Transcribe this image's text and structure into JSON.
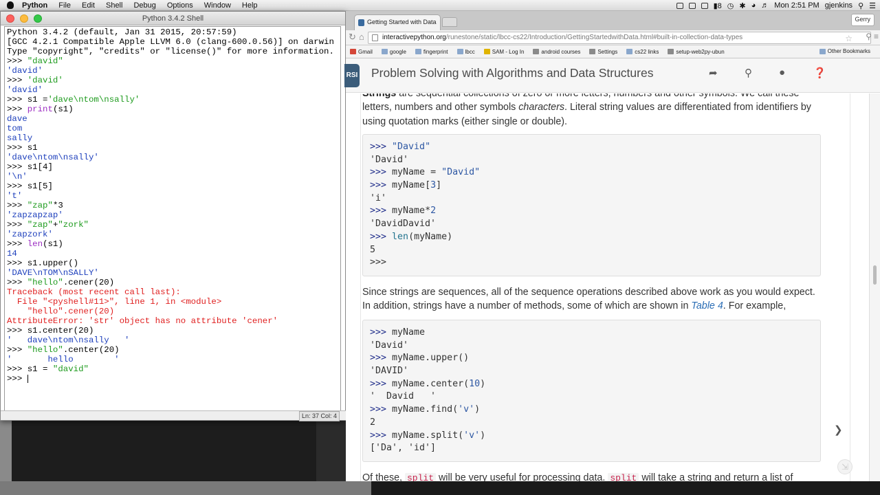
{
  "menubar": {
    "items": [
      "Python",
      "File",
      "Edit",
      "Shell",
      "Debug",
      "Options",
      "Window",
      "Help"
    ],
    "battery": "8",
    "clock": "Mon 2:51 PM",
    "user": "gjenkins"
  },
  "shell": {
    "title": "Python 3.4.2 Shell",
    "status": "Ln: 37 Col: 4",
    "lines": [
      {
        "segments": [
          {
            "t": "Python 3.4.2 (default, Jan 31 2015, 20:57:59)",
            "c": ""
          }
        ]
      },
      {
        "segments": [
          {
            "t": "[GCC 4.2.1 Compatible Apple LLVM 6.0 (clang-600.0.56)] on darwin",
            "c": ""
          }
        ]
      },
      {
        "segments": [
          {
            "t": "Type \"copyright\", \"credits\" or \"license()\" for more information.",
            "c": ""
          }
        ]
      },
      {
        "segments": [
          {
            "t": ">>> ",
            "c": ""
          },
          {
            "t": "\"david\"",
            "c": "str"
          }
        ]
      },
      {
        "segments": [
          {
            "t": "'david'",
            "c": "out"
          }
        ]
      },
      {
        "segments": [
          {
            "t": ">>> ",
            "c": ""
          },
          {
            "t": "'david'",
            "c": "str"
          }
        ]
      },
      {
        "segments": [
          {
            "t": "'david'",
            "c": "out"
          }
        ]
      },
      {
        "segments": [
          {
            "t": ">>> s1 =",
            "c": ""
          },
          {
            "t": "'dave\\ntom\\nsally'",
            "c": "str"
          }
        ]
      },
      {
        "segments": [
          {
            "t": ">>> ",
            "c": ""
          },
          {
            "t": "print",
            "c": "kw"
          },
          {
            "t": "(s1)",
            "c": ""
          }
        ]
      },
      {
        "segments": [
          {
            "t": "dave",
            "c": "out"
          }
        ]
      },
      {
        "segments": [
          {
            "t": "tom",
            "c": "out"
          }
        ]
      },
      {
        "segments": [
          {
            "t": "sally",
            "c": "out"
          }
        ]
      },
      {
        "segments": [
          {
            "t": ">>> s1",
            "c": ""
          }
        ]
      },
      {
        "segments": [
          {
            "t": "'dave\\ntom\\nsally'",
            "c": "out"
          }
        ]
      },
      {
        "segments": [
          {
            "t": ">>> s1[4]",
            "c": ""
          }
        ]
      },
      {
        "segments": [
          {
            "t": "'\\n'",
            "c": "out"
          }
        ]
      },
      {
        "segments": [
          {
            "t": ">>> s1[5]",
            "c": ""
          }
        ]
      },
      {
        "segments": [
          {
            "t": "'t'",
            "c": "out"
          }
        ]
      },
      {
        "segments": [
          {
            "t": ">>> ",
            "c": ""
          },
          {
            "t": "\"zap\"",
            "c": "str"
          },
          {
            "t": "*3",
            "c": ""
          }
        ]
      },
      {
        "segments": [
          {
            "t": "'zapzapzap'",
            "c": "out"
          }
        ]
      },
      {
        "segments": [
          {
            "t": ">>> ",
            "c": ""
          },
          {
            "t": "\"zap\"",
            "c": "str"
          },
          {
            "t": "+",
            "c": ""
          },
          {
            "t": "\"zork\"",
            "c": "str"
          }
        ]
      },
      {
        "segments": [
          {
            "t": "'zapzork'",
            "c": "out"
          }
        ]
      },
      {
        "segments": [
          {
            "t": ">>> ",
            "c": ""
          },
          {
            "t": "len",
            "c": "kw"
          },
          {
            "t": "(s1)",
            "c": ""
          }
        ]
      },
      {
        "segments": [
          {
            "t": "14",
            "c": "out"
          }
        ]
      },
      {
        "segments": [
          {
            "t": ">>> s1.upper()",
            "c": ""
          }
        ]
      },
      {
        "segments": [
          {
            "t": "'DAVE\\nTOM\\nSALLY'",
            "c": "out"
          }
        ]
      },
      {
        "segments": [
          {
            "t": ">>> ",
            "c": ""
          },
          {
            "t": "\"hello\"",
            "c": "str"
          },
          {
            "t": ".cener(20)",
            "c": ""
          }
        ]
      },
      {
        "segments": [
          {
            "t": "Traceback (most recent call last):",
            "c": "err"
          }
        ]
      },
      {
        "segments": [
          {
            "t": "  File \"<pyshell#11>\", line 1, in <module>",
            "c": "err"
          }
        ]
      },
      {
        "segments": [
          {
            "t": "    \"hello\".cener(20)",
            "c": "err"
          }
        ]
      },
      {
        "segments": [
          {
            "t": "AttributeError: 'str' object has no attribute 'cener'",
            "c": "err"
          }
        ]
      },
      {
        "segments": [
          {
            "t": ">>> s1.center(20)",
            "c": ""
          }
        ]
      },
      {
        "segments": [
          {
            "t": "'   dave\\ntom\\nsally   '",
            "c": "out"
          }
        ]
      },
      {
        "segments": [
          {
            "t": ">>> ",
            "c": ""
          },
          {
            "t": "\"hello\"",
            "c": "str"
          },
          {
            "t": ".center(20)",
            "c": ""
          }
        ]
      },
      {
        "segments": [
          {
            "t": "'       hello        '",
            "c": "out"
          }
        ]
      },
      {
        "segments": [
          {
            "t": ">>> s1 = ",
            "c": ""
          },
          {
            "t": "\"david\"",
            "c": "str"
          }
        ]
      },
      {
        "segments": [
          {
            "t": ">>> ",
            "c": ""
          }
        ],
        "caret": true
      }
    ]
  },
  "browser": {
    "tab_title": "Getting Started with Data",
    "profile": "Gerry",
    "url_domain": "interactivepython.org",
    "url_path": "/runestone/static/lbcc-cs22/Introduction/GettingStartedwithData.html#built-in-collection-data-types",
    "bookmarks": [
      {
        "label": "Gmail",
        "icon": "gmail-icon"
      },
      {
        "label": "google",
        "icon": "folder-icon"
      },
      {
        "label": "fingerprint",
        "icon": "folder-icon"
      },
      {
        "label": "lbcc",
        "icon": "folder-icon"
      },
      {
        "label": "SAM - Log In",
        "icon": "sam-icon"
      },
      {
        "label": "android courses",
        "icon": "page-icon"
      },
      {
        "label": "Settings",
        "icon": "gear-icon"
      },
      {
        "label": "cs22 links",
        "icon": "folder-icon"
      },
      {
        "label": "setup-web2py-ubun",
        "icon": "page-icon"
      }
    ],
    "other_bookmarks": "Other Bookmarks",
    "site_title": "Problem Solving with Algorithms and Data Structures",
    "logo_text": "RSI"
  },
  "content": {
    "p1": {
      "bold": "Strings",
      "text1": " are sequential collections of zero or more letters, numbers and other symbols. We call these letters, numbers and other symbols ",
      "italic": "characters",
      "text2": ". Literal string values are differentiated from identifiers by using quotation marks (either single or double)."
    },
    "code1": [
      [
        {
          "t": ">>> ",
          "c": "pr"
        },
        {
          "t": "\"David\"",
          "c": "s"
        }
      ],
      [
        {
          "t": "'David'",
          "c": ""
        }
      ],
      [
        {
          "t": ">>> ",
          "c": "pr"
        },
        {
          "t": "myName = ",
          "c": ""
        },
        {
          "t": "\"David\"",
          "c": "s"
        }
      ],
      [
        {
          "t": ">>> ",
          "c": "pr"
        },
        {
          "t": "myName[",
          "c": ""
        },
        {
          "t": "3",
          "c": "n"
        },
        {
          "t": "]",
          "c": ""
        }
      ],
      [
        {
          "t": "'i'",
          "c": ""
        }
      ],
      [
        {
          "t": ">>> ",
          "c": "pr"
        },
        {
          "t": "myName*",
          "c": ""
        },
        {
          "t": "2",
          "c": "n"
        }
      ],
      [
        {
          "t": "'DavidDavid'",
          "c": ""
        }
      ],
      [
        {
          "t": ">>> ",
          "c": "pr"
        },
        {
          "t": "len",
          "c": "f"
        },
        {
          "t": "(myName)",
          "c": ""
        }
      ],
      [
        {
          "t": "5",
          "c": ""
        }
      ],
      [
        {
          "t": ">>>",
          "c": ""
        }
      ]
    ],
    "p2": {
      "text1": "Since strings are sequences, all of the sequence operations described above work as you would expect. In addition, strings have a number of methods, some of which are shown in ",
      "link": "Table 4",
      "text2": ". For example,"
    },
    "code2": [
      [
        {
          "t": ">>> ",
          "c": "pr"
        },
        {
          "t": "myName",
          "c": ""
        }
      ],
      [
        {
          "t": "'David'",
          "c": ""
        }
      ],
      [
        {
          "t": ">>> ",
          "c": "pr"
        },
        {
          "t": "myName.upper()",
          "c": ""
        }
      ],
      [
        {
          "t": "'DAVID'",
          "c": ""
        }
      ],
      [
        {
          "t": ">>> ",
          "c": "pr"
        },
        {
          "t": "myName.center(",
          "c": ""
        },
        {
          "t": "10",
          "c": "n"
        },
        {
          "t": ")",
          "c": ""
        }
      ],
      [
        {
          "t": "'  David   '",
          "c": ""
        }
      ],
      [
        {
          "t": ">>> ",
          "c": "pr"
        },
        {
          "t": "myName.find(",
          "c": ""
        },
        {
          "t": "'v'",
          "c": "s"
        },
        {
          "t": ")",
          "c": ""
        }
      ],
      [
        {
          "t": "2",
          "c": ""
        }
      ],
      [
        {
          "t": ">>> ",
          "c": "pr"
        },
        {
          "t": "myName.split(",
          "c": ""
        },
        {
          "t": "'v'",
          "c": "s"
        },
        {
          "t": ")",
          "c": ""
        }
      ],
      [
        {
          "t": "['Da', 'id']",
          "c": ""
        }
      ]
    ],
    "p3": {
      "text1": "Of these, ",
      "code_a": "split",
      "text2": " will be very useful for processing data. ",
      "code_b": "split",
      "text3": " will take a string and return a list of"
    }
  }
}
